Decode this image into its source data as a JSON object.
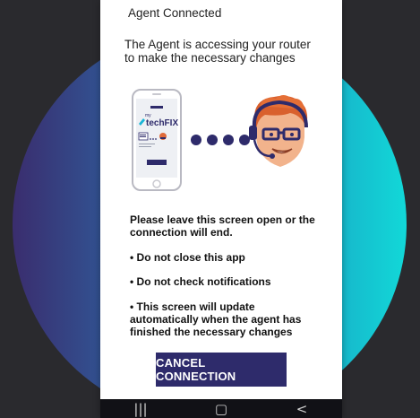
{
  "status": {
    "title": "Agent Connected"
  },
  "intro": {
    "text": "The Agent is accessing your router to make the necessary changes"
  },
  "illustration": {
    "phone_icon": "smartphone-icon",
    "logo_text_top": "my",
    "logo_text": "techFIX",
    "dots_icon": "connection-dots-icon",
    "agent_icon": "agent-headset-avatar-icon"
  },
  "message": {
    "line1": "Please leave this screen open or the connection will end.",
    "bullet1": "• Do not close this app",
    "bullet2": "• Do not check notifications",
    "bullet3": "• This screen will update automatically when the agent has finished the necessary changes"
  },
  "actions": {
    "cancel_label": "CANCEL CONNECTION"
  },
  "navbar": {
    "recents": "|||",
    "home": "▢",
    "back": "<"
  },
  "colors": {
    "button": "#2e2b6b",
    "accent_cyan": "#12d8d8",
    "accent_purple": "#3a2d6e"
  }
}
